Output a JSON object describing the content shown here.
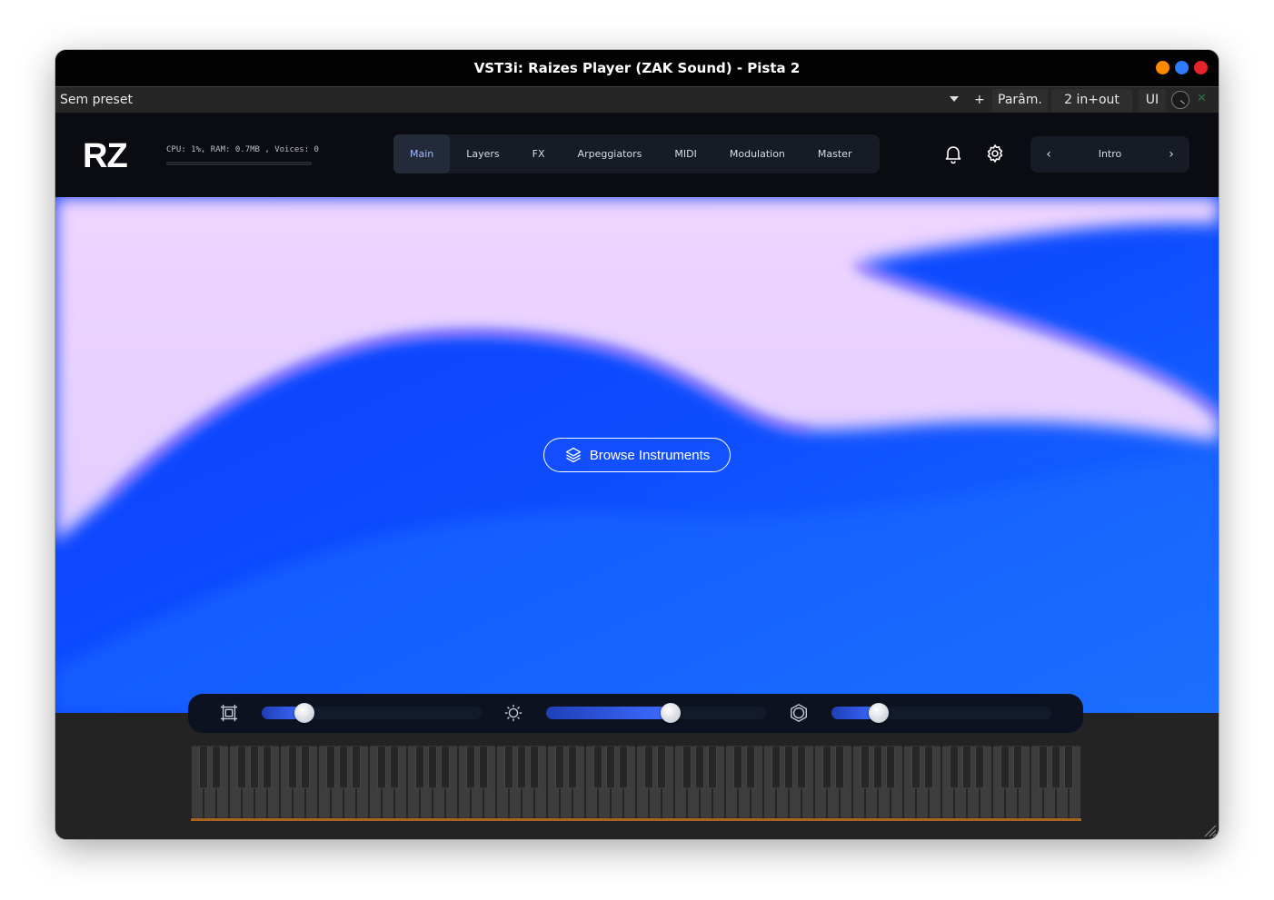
{
  "window": {
    "title": "VST3i: Raizes Player (ZAK Sound) - Pista 2",
    "traffic_lights": [
      "#ff8a00",
      "#2f7bff",
      "#e5232a"
    ]
  },
  "host_bar": {
    "preset": "Sem preset",
    "add_label": "+",
    "param_label": "Parâm.",
    "io_label": "2 in+out",
    "ui_label": "UI"
  },
  "plugin": {
    "logo": "RZ",
    "stats": "CPU: 1%, RAM: 0.7MB , Voices: 0",
    "tabs": [
      {
        "label": "Main",
        "active": true
      },
      {
        "label": "Layers",
        "active": false
      },
      {
        "label": "FX",
        "active": false
      },
      {
        "label": "Arpeggiators",
        "active": false
      },
      {
        "label": "MIDI",
        "active": false
      },
      {
        "label": "Modulation",
        "active": false
      },
      {
        "label": "Master",
        "active": false
      }
    ],
    "preset_nav": {
      "label": "Intro",
      "prev": "‹",
      "next": "›"
    },
    "icons": {
      "notifications": "bell-icon",
      "settings": "gear-icon"
    }
  },
  "hero": {
    "browse_label": "Browse Instruments",
    "browse_icon": "layers-icon",
    "colors": {
      "lavender": "#ecd6ff",
      "blue": "#1668ff"
    }
  },
  "macros": [
    {
      "icon": "frame-icon",
      "value": 0.17
    },
    {
      "icon": "brightness-icon",
      "value": 0.54
    },
    {
      "icon": "hexagon-icon",
      "value": 0.19
    }
  ],
  "keyboard": {
    "octaves": 10,
    "accent": "#a8641e"
  }
}
